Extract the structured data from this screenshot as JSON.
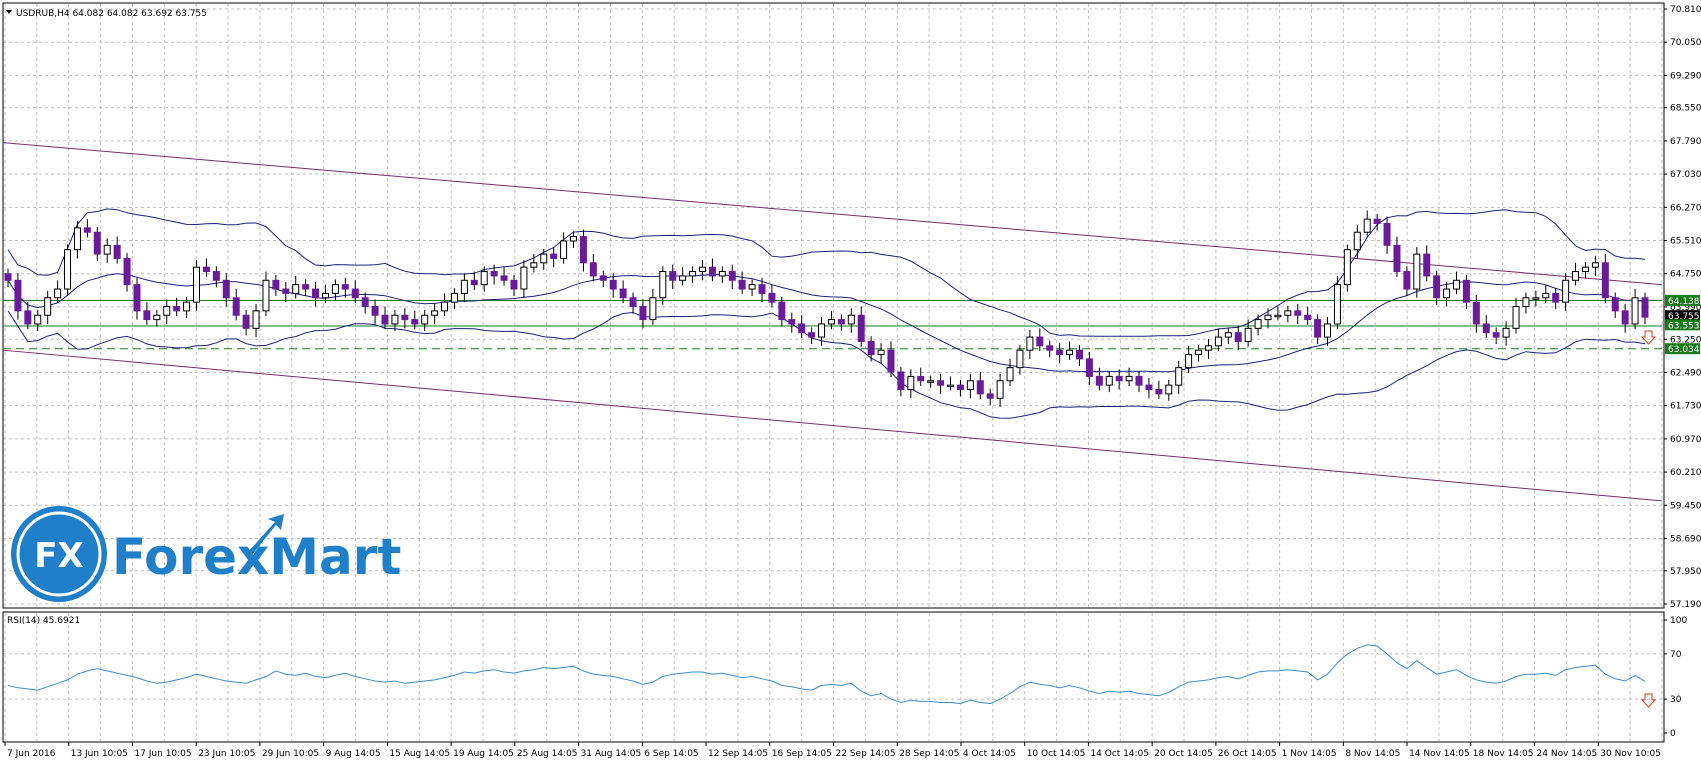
{
  "chart_data": {
    "type": "candlestick",
    "symbol_line": "USDRUB,H4  64.082 64.082 63.692 63.755",
    "price_ticks": [
      "70.810",
      "70.050",
      "69.290",
      "68.550",
      "67.790",
      "67.030",
      "66.270",
      "65.510",
      "64.750",
      "63.990",
      "63.250",
      "62.490",
      "61.730",
      "60.970",
      "60.210",
      "59.450",
      "58.690",
      "57.950",
      "57.190"
    ],
    "price_range": [
      57.19,
      70.81
    ],
    "time_labels": [
      "7 Jun 2016",
      "13 Jun 10:05",
      "17 Jun 10:05",
      "23 Jun 10:05",
      "29 Jun 10:05",
      "9 Aug 14:05",
      "15 Aug 14:05",
      "19 Aug 14:05",
      "25 Aug 14:05",
      "31 Aug 14:05",
      "6 Sep 14:05",
      "12 Sep 14:05",
      "16 Sep 14:05",
      "22 Sep 14:05",
      "28 Sep 14:05",
      "4 Oct 14:05",
      "10 Oct 14:05",
      "14 Oct 14:05",
      "20 Oct 14:05",
      "26 Oct 14:05",
      "1 Nov 14:05",
      "8 Nov 14:05",
      "14 Nov 14:05",
      "18 Nov 14:05",
      "24 Nov 14:05",
      "30 Nov 10:05"
    ],
    "price_tags": [
      {
        "value": "64.138",
        "color": "#1b7a1b",
        "price": 64.138
      },
      {
        "value": "63.755",
        "color": "#000000",
        "price": 63.79
      },
      {
        "value": "63.553",
        "color": "#1b7a1b",
        "price": 63.58
      },
      {
        "value": "63.034",
        "color": "#1b7a1b",
        "price": 63.034
      }
    ],
    "horizontal_levels": [
      64.138,
      63.553
    ],
    "dashed_level": 63.034,
    "channel": {
      "upper": [
        67.75,
        64.5
      ],
      "lower": [
        63.0,
        59.55
      ]
    },
    "closes": [
      64.6,
      63.9,
      63.6,
      63.8,
      64.2,
      64.4,
      65.3,
      65.8,
      65.7,
      65.2,
      65.4,
      65.1,
      64.5,
      63.9,
      63.7,
      63.8,
      64.0,
      63.9,
      64.1,
      64.9,
      64.8,
      64.6,
      64.2,
      63.8,
      63.5,
      63.9,
      64.6,
      64.4,
      64.3,
      64.5,
      64.4,
      64.2,
      64.3,
      64.5,
      64.4,
      64.2,
      64.0,
      63.8,
      63.6,
      63.8,
      63.7,
      63.6,
      63.8,
      63.9,
      64.1,
      64.3,
      64.6,
      64.5,
      64.8,
      64.7,
      64.6,
      64.4,
      64.9,
      65.0,
      65.2,
      65.1,
      65.5,
      65.6,
      65.0,
      64.7,
      64.6,
      64.4,
      64.2,
      64.0,
      63.7,
      64.2,
      64.8,
      64.6,
      64.7,
      64.8,
      64.9,
      64.7,
      64.8,
      64.6,
      64.4,
      64.5,
      64.3,
      64.1,
      63.7,
      63.6,
      63.4,
      63.3,
      63.6,
      63.7,
      63.6,
      63.8,
      63.2,
      62.9,
      63.0,
      62.5,
      62.1,
      62.4,
      62.3,
      62.3,
      62.2,
      62.2,
      62.1,
      62.3,
      62.0,
      61.9,
      62.3,
      62.6,
      63.0,
      63.3,
      63.1,
      63.0,
      62.9,
      63.0,
      62.8,
      62.4,
      62.2,
      62.4,
      62.3,
      62.4,
      62.2,
      62.1,
      62.0,
      62.2,
      62.6,
      62.9,
      63.0,
      63.1,
      63.3,
      63.4,
      63.2,
      63.5,
      63.7,
      63.8,
      63.8,
      63.9,
      63.8,
      63.7,
      63.3,
      63.6,
      64.5,
      65.3,
      65.7,
      66.0,
      65.9,
      65.4,
      64.8,
      64.4,
      65.2,
      64.7,
      64.2,
      64.4,
      64.6,
      64.1,
      63.6,
      63.4,
      63.3,
      63.5,
      64.0,
      64.2,
      64.2,
      64.3,
      64.1,
      64.6,
      64.8,
      64.9,
      65.0,
      64.2,
      63.9,
      63.6,
      64.2,
      63.755
    ],
    "rsi": {
      "label": "RSI(14) 45.6921",
      "ticks": [
        "100",
        "70",
        "30",
        "0"
      ],
      "range": [
        0,
        100
      ],
      "values": [
        42,
        40,
        39,
        38,
        41,
        44,
        47,
        52,
        55,
        57,
        55,
        53,
        51,
        49,
        46,
        44,
        45,
        47,
        49,
        52,
        50,
        48,
        46,
        45,
        44,
        47,
        50,
        55,
        52,
        51,
        53,
        50,
        49,
        51,
        53,
        50,
        48,
        46,
        45,
        46,
        44,
        45,
        46,
        47,
        49,
        51,
        54,
        53,
        55,
        56,
        54,
        53,
        55,
        56,
        58,
        57,
        58,
        59,
        55,
        52,
        51,
        50,
        48,
        46,
        43,
        45,
        50,
        52,
        53,
        54,
        54,
        52,
        53,
        51,
        49,
        50,
        48,
        46,
        42,
        41,
        39,
        38,
        42,
        43,
        42,
        44,
        37,
        33,
        35,
        30,
        27,
        29,
        28,
        28,
        27,
        27,
        26,
        29,
        27,
        26,
        30,
        35,
        41,
        45,
        43,
        42,
        40,
        42,
        40,
        37,
        35,
        37,
        36,
        37,
        35,
        34,
        33,
        36,
        41,
        45,
        46,
        47,
        49,
        50,
        48,
        51,
        54,
        55,
        55,
        56,
        55,
        54,
        47,
        52,
        62,
        70,
        75,
        78,
        77,
        70,
        62,
        57,
        64,
        58,
        52,
        54,
        56,
        51,
        47,
        45,
        44,
        46,
        50,
        52,
        52,
        53,
        51,
        56,
        58,
        59,
        60,
        52,
        48,
        46,
        51,
        45.7
      ]
    }
  },
  "logo": {
    "badge": "FX",
    "name": "ForexMart"
  }
}
